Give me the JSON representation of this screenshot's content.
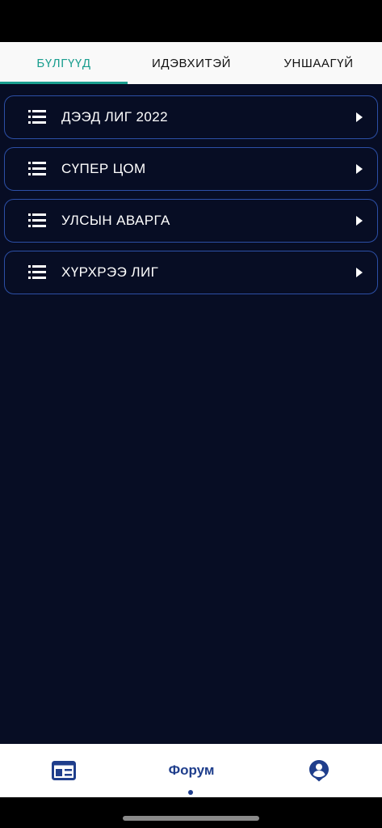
{
  "tabs": [
    {
      "label": "БҮЛГҮҮД",
      "active": true
    },
    {
      "label": "ИДЭВХИТЭЙ",
      "active": false
    },
    {
      "label": "УНШААГҮЙ",
      "active": false
    }
  ],
  "categories": [
    {
      "label": "ДЭЭД ЛИГ 2022",
      "icon": "list-icon"
    },
    {
      "label": "СҮПЕР ЦОМ",
      "icon": "list-icon"
    },
    {
      "label": "УЛСЫН АВАРГА",
      "icon": "list-icon"
    },
    {
      "label": "ХҮРХРЭЭ ЛИГ",
      "icon": "list-icon"
    }
  ],
  "fab": {
    "icon": "plus-icon"
  },
  "bottom_nav": {
    "items": [
      {
        "icon": "news-icon",
        "label": ""
      },
      {
        "icon": "",
        "label": "Форум",
        "active": true
      },
      {
        "icon": "profile-icon",
        "label": ""
      }
    ]
  },
  "colors": {
    "accent": "#1a9e8f",
    "background": "#070d24",
    "border": "#2c4fa6",
    "nav_active": "#1f3e8c"
  }
}
